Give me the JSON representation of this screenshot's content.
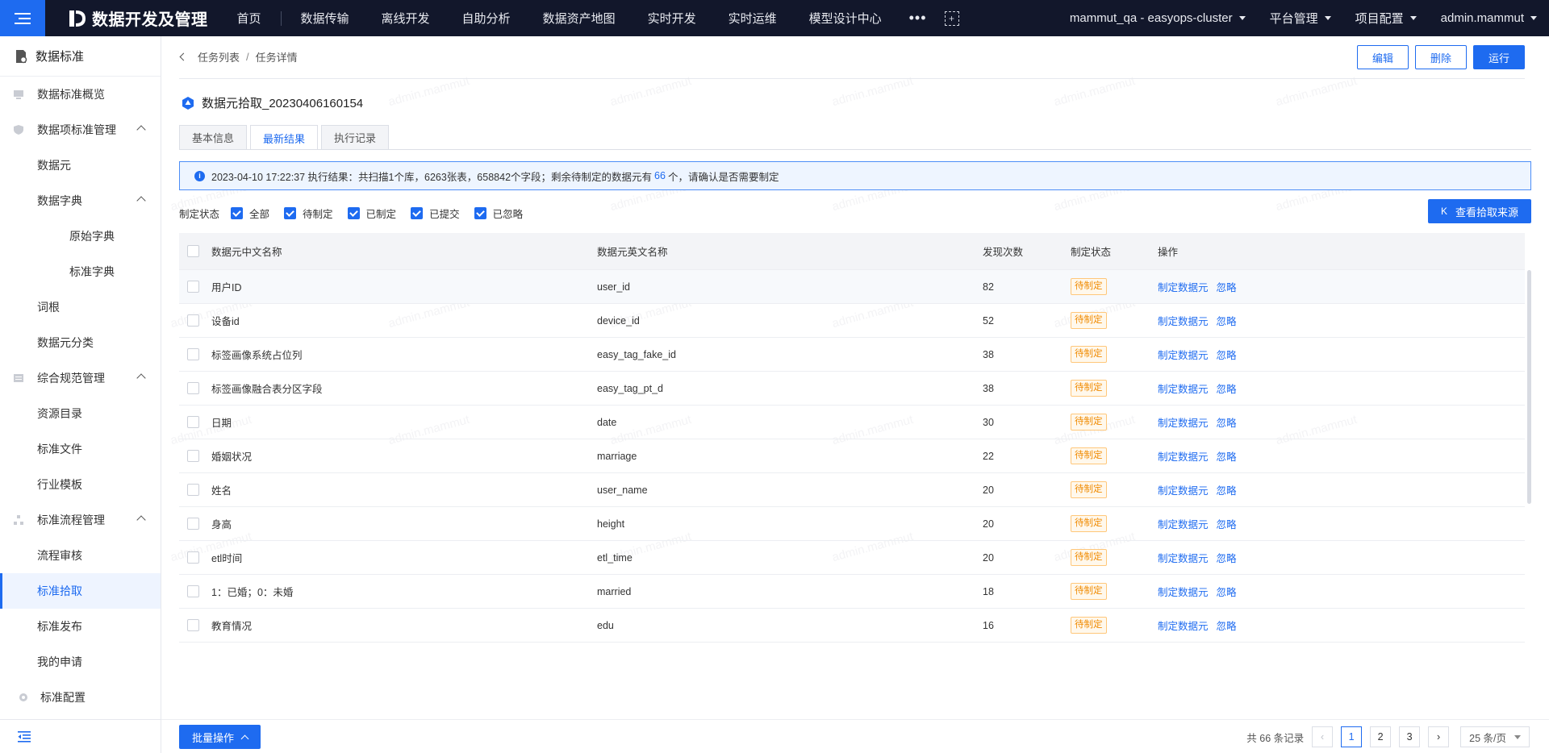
{
  "app": {
    "title": "数据开发及管理",
    "nav": [
      "首页",
      "数据传输",
      "离线开发",
      "自助分析",
      "数据资产地图",
      "实时开发",
      "实时运维",
      "模型设计中心"
    ],
    "cluster": "mammut_qa - easyops-cluster",
    "platform": "平台管理",
    "project": "项目配置",
    "user": "admin.mammut"
  },
  "sidebar": {
    "header": "数据标准",
    "items": [
      {
        "label": "数据标准概览"
      },
      {
        "label": "数据项标准管理"
      },
      {
        "label": "数据元"
      },
      {
        "label": "数据字典"
      },
      {
        "label": "原始字典"
      },
      {
        "label": "标准字典"
      },
      {
        "label": "词根"
      },
      {
        "label": "数据元分类"
      },
      {
        "label": "综合规范管理"
      },
      {
        "label": "资源目录"
      },
      {
        "label": "标准文件"
      },
      {
        "label": "行业模板"
      },
      {
        "label": "标准流程管理"
      },
      {
        "label": "流程审核"
      },
      {
        "label": "标准拾取"
      },
      {
        "label": "标准发布"
      },
      {
        "label": "我的申请"
      },
      {
        "label": "标准配置"
      }
    ]
  },
  "breadcrumb": {
    "parent": "任务列表",
    "sep": "/",
    "current": "任务详情"
  },
  "actions": {
    "edit": "编辑",
    "delete": "删除",
    "run": "运行"
  },
  "task": {
    "title": "数据元拾取_20230406160154"
  },
  "tabs": [
    "基本信息",
    "最新结果",
    "执行记录"
  ],
  "alert": {
    "prefix": "2023-04-10 17:22:37 执行结果：共扫描1个库，6263张表，658842个字段；剩余待制定的数据元有",
    "count": "66",
    "suffix": "个，请确认是否需要制定"
  },
  "filter": {
    "label": "制定状态",
    "options": [
      "全部",
      "待制定",
      "已制定",
      "已提交",
      "已忽略"
    ]
  },
  "view_source": "查看拾取来源",
  "table": {
    "headers": [
      "数据元中文名称",
      "数据元英文名称",
      "发现次数",
      "制定状态",
      "操作"
    ],
    "rows": [
      {
        "cn": "用户ID",
        "en": "user_id",
        "count": "82",
        "status": "待制定"
      },
      {
        "cn": "设备id",
        "en": "device_id",
        "count": "52",
        "status": "待制定"
      },
      {
        "cn": "标签画像系统占位列",
        "en": "easy_tag_fake_id",
        "count": "38",
        "status": "待制定"
      },
      {
        "cn": "标签画像融合表分区字段",
        "en": "easy_tag_pt_d",
        "count": "38",
        "status": "待制定"
      },
      {
        "cn": "日期",
        "en": "date",
        "count": "30",
        "status": "待制定"
      },
      {
        "cn": "婚姻状况",
        "en": "marriage",
        "count": "22",
        "status": "待制定"
      },
      {
        "cn": "姓名",
        "en": "user_name",
        "count": "20",
        "status": "待制定"
      },
      {
        "cn": "身高",
        "en": "height",
        "count": "20",
        "status": "待制定"
      },
      {
        "cn": "etl时间",
        "en": "etl_time",
        "count": "20",
        "status": "待制定"
      },
      {
        "cn": "1：已婚；0：未婚",
        "en": "married",
        "count": "18",
        "status": "待制定"
      },
      {
        "cn": "教育情况",
        "en": "edu",
        "count": "16",
        "status": "待制定"
      }
    ],
    "op_define": "制定数据元",
    "op_ignore": "忽略"
  },
  "footer": {
    "batch": "批量操作",
    "total": "共 66 条记录",
    "pages": [
      "1",
      "2",
      "3"
    ],
    "page_size": "25 条/页"
  },
  "watermark": "admin.mammut",
  "colors": {
    "accent": "#1e6bf0",
    "topbar": "#12172b",
    "pending": "#f08a00"
  }
}
